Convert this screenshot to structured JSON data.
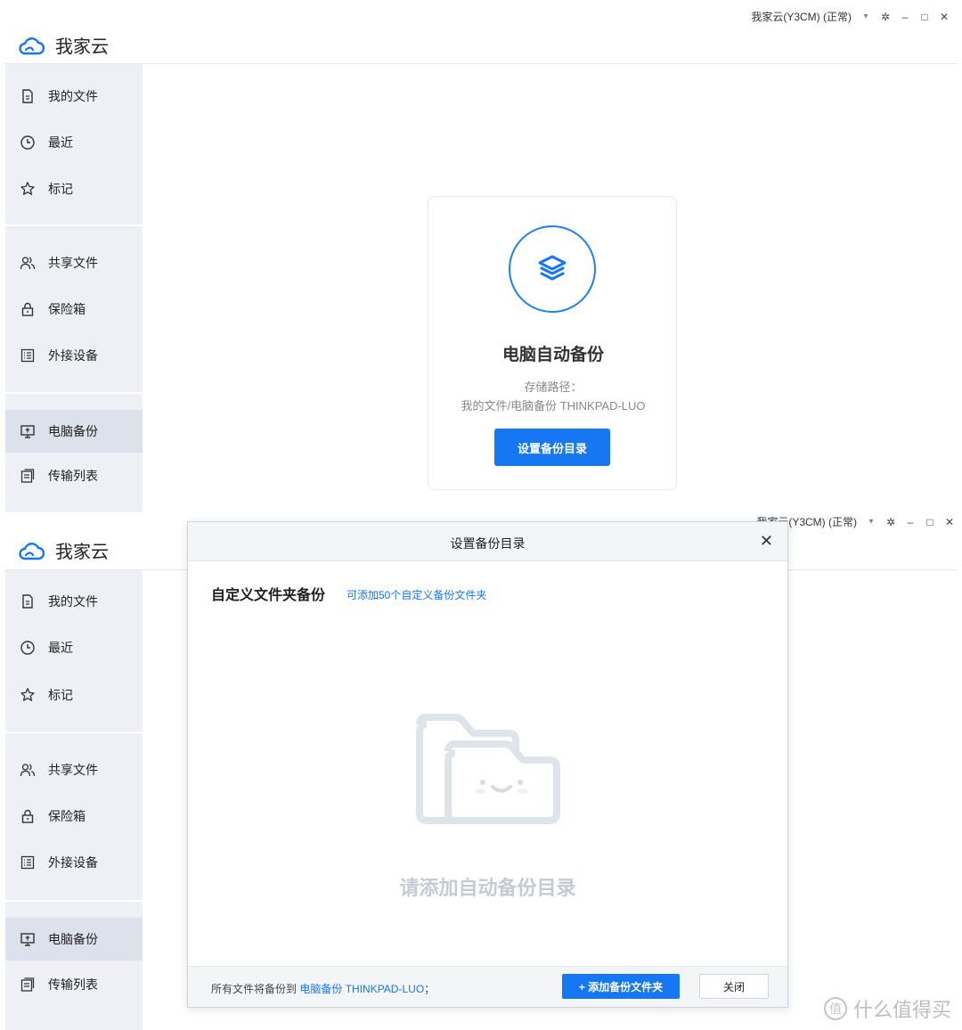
{
  "app": {
    "name": "我家云"
  },
  "window": {
    "account": "我家云(Y3CM) (正常)",
    "account_overlapped": "我家云(Y3CM) (正常)",
    "dropdown_glyph": "▾",
    "settings_glyph": "✲",
    "minimize_glyph": "–",
    "maximize_glyph": "□",
    "close_glyph": "✕"
  },
  "sidebar": {
    "items": [
      {
        "label": "我的文件",
        "icon": "file-icon"
      },
      {
        "label": "最近",
        "icon": "clock-icon"
      },
      {
        "label": "标记",
        "icon": "star-icon"
      },
      {
        "label": "共享文件",
        "icon": "users-icon"
      },
      {
        "label": "保险箱",
        "icon": "lock-icon"
      },
      {
        "label": "外接设备",
        "icon": "device-list-icon"
      },
      {
        "label": "电脑备份",
        "icon": "monitor-icon"
      },
      {
        "label": "传输列表",
        "icon": "transfer-list-icon"
      }
    ],
    "active_index": 6
  },
  "backup_card": {
    "title": "电脑自动备份",
    "path_label": "存储路径：",
    "path_value": "我的文件/电脑备份 THINKPAD-LUO",
    "button_label": "设置备份目录",
    "icon": "layers-icon"
  },
  "dialog": {
    "title": "设置备份目录",
    "close_glyph": "✕",
    "section_title": "自定义文件夹备份",
    "section_hint": "可添加50个自定义备份文件夹",
    "empty_text": "请添加自动备份目录",
    "footer_prefix": "所有文件将备份到",
    "footer_link": "电脑备份 THINKPAD-LUO",
    "footer_suffix": "；",
    "add_button": "+ 添加备份文件夹",
    "close_button": "关闭"
  },
  "watermark": {
    "text": "什么值得买"
  },
  "colors": {
    "accent": "#1677f2",
    "sidebar_bg": "#eef0f5",
    "sidebar_active": "#dde1ec"
  }
}
